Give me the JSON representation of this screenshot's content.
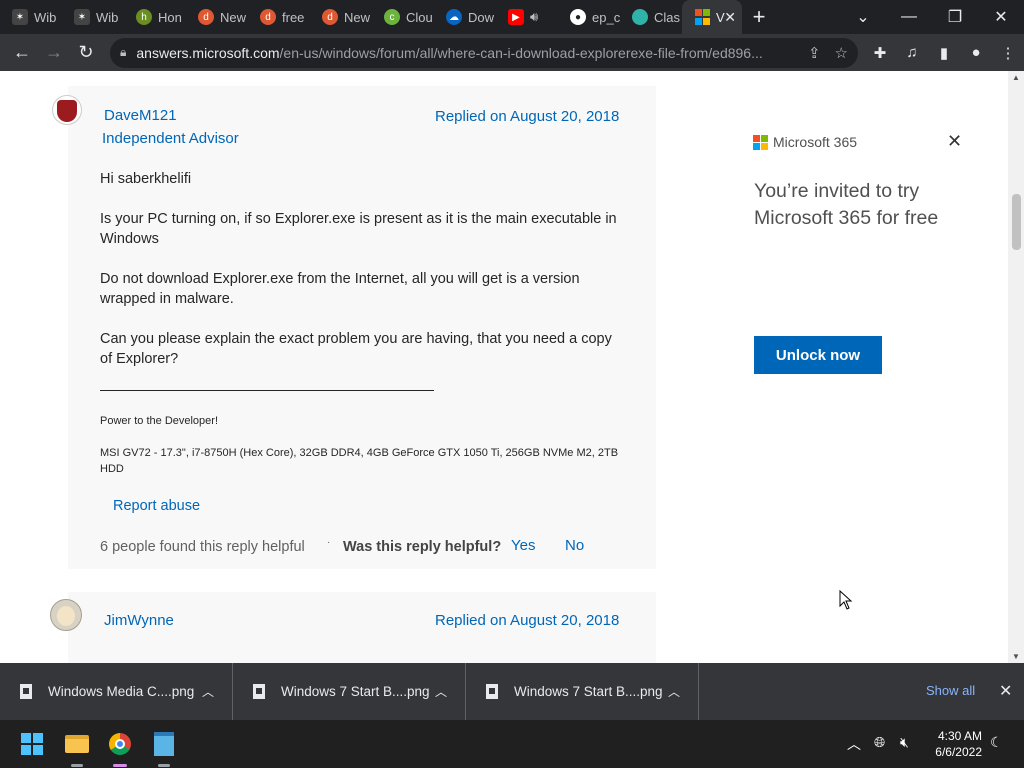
{
  "browser": {
    "tabs": [
      {
        "label": "Wib",
        "icon": "wibbitz-icon",
        "color": "#202124"
      },
      {
        "label": "Wib",
        "icon": "wibbitz-icon",
        "color": "#202124"
      },
      {
        "label": "Hon",
        "icon": "honey-icon",
        "color": "#6b8e23"
      },
      {
        "label": "New",
        "icon": "duckduckgo-icon",
        "color": "#de5833"
      },
      {
        "label": "free",
        "icon": "duckduckgo-icon",
        "color": "#de5833"
      },
      {
        "label": "New",
        "icon": "duckduckgo-icon",
        "color": "#de5833"
      },
      {
        "label": "Clou",
        "icon": "cloud-icon",
        "color": "#6cb33e"
      },
      {
        "label": "Dow",
        "icon": "onedrive-icon",
        "color": "#0a64c2"
      },
      {
        "label": "",
        "icon": "youtube-icon",
        "color": "#ff0000"
      },
      {
        "label": "ep_c",
        "icon": "github-icon",
        "color": "#202124"
      },
      {
        "label": "Clas",
        "icon": "edge-icon",
        "color": "#2fb2a8"
      },
      {
        "label": "V",
        "icon": "microsoft-icon",
        "color": "#202124"
      }
    ],
    "url_host": "answers.microsoft.com",
    "url_path": "/en-us/windows/forum/all/where-can-i-download-explorerexe-file-from/ed896..."
  },
  "reply1": {
    "author": "DaveM121",
    "role": "Independent Advisor",
    "date": "Replied on August 20, 2018",
    "greeting": "Hi saberkhelifi",
    "para1": "Is your PC turning on, if so Explorer.exe is present as it is the main executable in Windows",
    "para2": "Do not download Explorer.exe from the Internet, all you will get is a version wrapped in malware.",
    "para3": "Can you please explain the exact problem you are having, that you need a copy of Explorer?",
    "sig1": "Power to the Developer!",
    "sig2": "MSI GV72 - 17.3\", i7-8750H (Hex Core), 32GB DDR4, 4GB GeForce GTX 1050 Ti, 256GB NVMe M2, 2TB HDD",
    "report": "Report abuse",
    "helpful_count": "6 people found this reply helpful",
    "dot": "·",
    "was_helpful": "Was this reply helpful?",
    "yes": "Yes",
    "no": "No"
  },
  "reply2": {
    "author": "JimWynne",
    "date": "Replied on August 20, 2018"
  },
  "ad": {
    "brand": "Microsoft 365",
    "headline": "You’re invited to try Microsoft 365 for free",
    "button": "Unlock now",
    "logo_colors": [
      "#f25022",
      "#7fba00",
      "#00a4ef",
      "#ffb900"
    ]
  },
  "downloads": {
    "items": [
      "Windows Media C....png",
      "Windows 7 Start B....png",
      "Windows 7 Start B....png"
    ],
    "show_all": "Show all"
  },
  "taskbar": {
    "time": "4:30 AM",
    "date": "6/6/2022"
  }
}
